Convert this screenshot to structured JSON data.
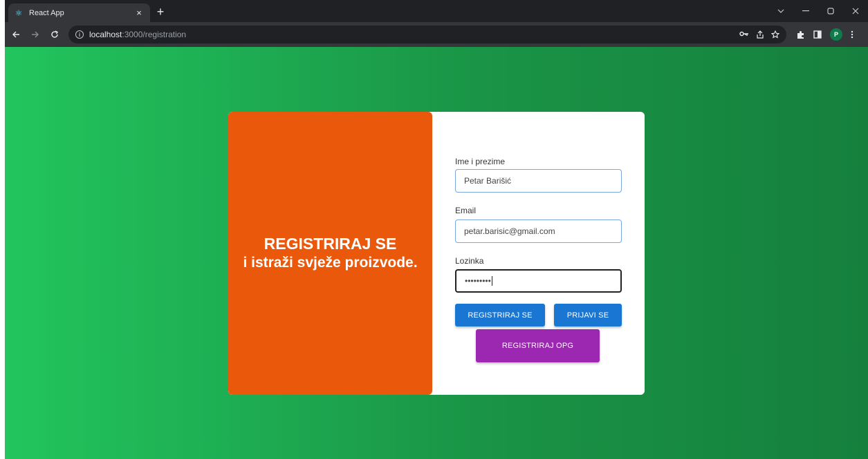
{
  "browser": {
    "tab_title": "React App",
    "tab_close": "×",
    "new_tab": "+",
    "url_host": "localhost",
    "url_path": ":3000/registration",
    "profile_initial": "P",
    "icons": [
      "react-favicon",
      "back-arrow",
      "forward-arrow",
      "reload",
      "info",
      "key",
      "share",
      "star",
      "puzzle",
      "sidebar",
      "more-vertical",
      "chevron-down",
      "minimize",
      "maximize",
      "close"
    ]
  },
  "hero": {
    "title": "REGISTRIRAJ SE",
    "subtitle": "i istraži svježe proizvode."
  },
  "form": {
    "name_label": "Ime i prezime",
    "name_value": "Petar Barišić",
    "email_label": "Email",
    "email_value": "petar.barisic@gmail.com",
    "password_label": "Lozinka",
    "password_value": "•••••••••",
    "register_button": "REGISTRIRAJ SE",
    "login_button": "PRIJAVI SE",
    "register_opg_button": "REGISTRIRAJ OPG"
  },
  "colors": {
    "background_start": "#22c55e",
    "background_end": "#15803d",
    "hero_panel": "#ea580c",
    "primary_button": "#1976d2",
    "opg_button": "#9c27b0"
  }
}
